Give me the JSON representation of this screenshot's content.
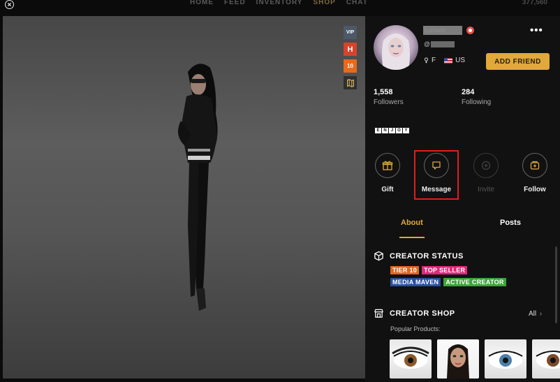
{
  "nav": {
    "items": [
      "HOME",
      "FEED",
      "INVENTORY",
      "SHOP",
      "CHAT"
    ],
    "active": "SHOP",
    "coins": "377,560"
  },
  "viewport": {
    "badges": [
      "VIP",
      "H",
      "10",
      "map-icon"
    ]
  },
  "profile": {
    "username": "Lunaxo",
    "handle_prefix": "@",
    "gender": "F",
    "country": "US",
    "add_friend_label": "ADD FRIEND",
    "more_label": "•••",
    "followers_count": "1,558",
    "followers_label": "Followers",
    "following_count": "284",
    "following_label": "Following",
    "bio_letters": [
      "E",
      "N",
      "J",
      "O",
      "Y"
    ]
  },
  "actions": {
    "gift": "Gift",
    "message": "Message",
    "invite": "Invite",
    "follow": "Follow"
  },
  "tabs": {
    "about": "About",
    "posts": "Posts"
  },
  "creator_status": {
    "title": "CREATOR STATUS",
    "tags": [
      {
        "label": "TIER 10",
        "color": "#e4641c"
      },
      {
        "label": "TOP SELLER",
        "color": "#e0287a"
      },
      {
        "label": "MEDIA MAVEN",
        "color": "#2a4fa0"
      },
      {
        "label": "ACTIVE CREATOR",
        "color": "#3ea33a"
      }
    ]
  },
  "creator_shop": {
    "title": "CREATOR SHOP",
    "all_label": "All",
    "popular_label": "Popular Products:"
  },
  "colors": {
    "accent": "#e0a93a",
    "highlight": "#e01e1e",
    "panel_bg": "#111111"
  }
}
